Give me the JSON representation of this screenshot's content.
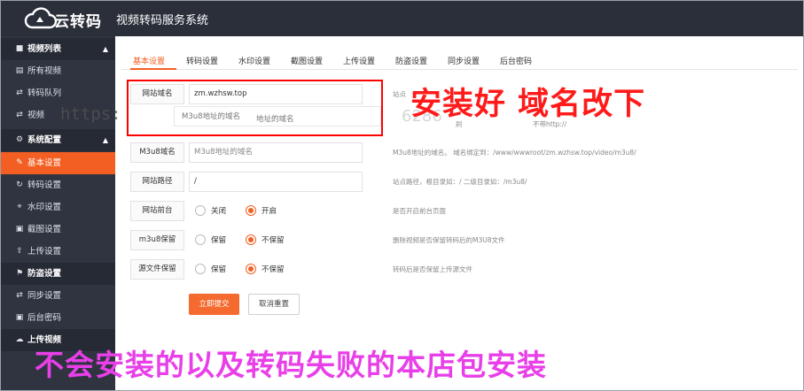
{
  "brand": {
    "logo_text": "云转码",
    "app_title": "视频转码服务系统"
  },
  "sidebar": {
    "items": [
      {
        "label": "视频列表",
        "icon": "video-icon",
        "group": true
      },
      {
        "label": "所有视频",
        "icon": "list-icon"
      },
      {
        "label": "转码队列",
        "icon": "exchange-icon"
      },
      {
        "label": "视频",
        "icon": "exchange-icon"
      },
      {
        "label": "系统配置",
        "icon": "gear-icon",
        "group": true
      },
      {
        "label": "基本设置",
        "icon": "edit-icon",
        "active": true
      },
      {
        "label": "转码设置",
        "icon": "refresh-icon"
      },
      {
        "label": "水印设置",
        "icon": "crop-icon"
      },
      {
        "label": "截图设置",
        "icon": "image-icon"
      },
      {
        "label": "上传设置",
        "icon": "upload-icon"
      },
      {
        "label": "防盗设置",
        "icon": "flag-icon"
      },
      {
        "label": "同步设置",
        "icon": "exchange-icon"
      },
      {
        "label": "后台密码",
        "icon": "lock-icon"
      },
      {
        "label": "上传视频",
        "icon": "cloud-upload-icon"
      }
    ]
  },
  "tabs": [
    "基本设置",
    "转码设置",
    "水印设置",
    "截图设置",
    "上传设置",
    "防盗设置",
    "同步设置",
    "后台密码"
  ],
  "form": {
    "site_domain": {
      "label": "网站域名",
      "value": "zm.wzhsw.top",
      "hint": "站点"
    },
    "m3u8_domain": {
      "label": "M3u8域名",
      "placeholder": "M3u8地址的域名",
      "hint": "M3u8地址的域名。 域名绑定到：/www/wwwroot/zm.wzhsw.top/video/m3u8/"
    },
    "site_path": {
      "label": "网站路径",
      "value": "/",
      "hint": "站点路径，根目录如：/ 二级目录如：/m3u8/"
    },
    "frontend": {
      "label": "网站前台",
      "options": [
        "关闭",
        "开启"
      ],
      "selected": "开启",
      "hint": "是否开启前台页面"
    },
    "m3u8_keep": {
      "label": "m3u8保留",
      "options": [
        "保留",
        "不保留"
      ],
      "selected": "不保留",
      "hint": "删除视频是否保留转码后的M3U8文件"
    },
    "source_keep": {
      "label": "源文件保留",
      "options": [
        "保留",
        "不保留"
      ],
      "selected": "不保留",
      "hint": "转码后是否保留上传源文件"
    },
    "submit_label": "立即提交",
    "cancel_label": "取消重置"
  },
  "overlay": {
    "ghost_label1": "M3u8地址的域名",
    "ghost_label2": "地址的域名",
    "https_text": "https:",
    "ghost_number": "6286",
    "ghost_hint_a": "刷",
    "ghost_hint_b": "不带http://",
    "annotation_top": "安装好 域名改下",
    "annotation_bottom": "不会安装的以及转码失败的本店包安装",
    "annotation_top_color": "#ff1a1a",
    "annotation_bottom_color": "#e83fe8",
    "box_color": "#ff0000"
  },
  "colors": {
    "accent": "#f35f22",
    "sidebar_bg": "#2f3440",
    "topbar_bg": "#2b2f3a"
  }
}
